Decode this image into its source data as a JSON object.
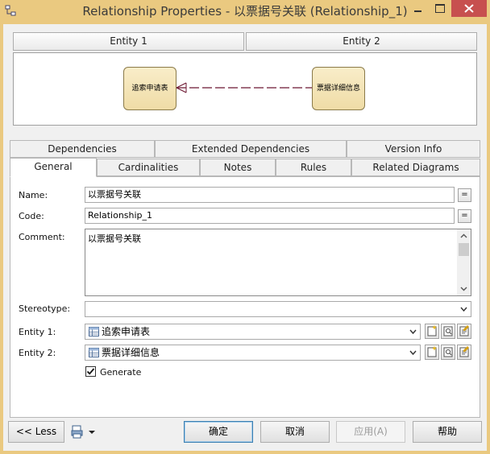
{
  "window": {
    "title": "Relationship Properties - 以票据号关联 (Relationship_1)",
    "title_bar_color": "#eac980",
    "close_color": "#c7504f"
  },
  "diagram": {
    "headers": [
      "Entity 1",
      "Entity 2"
    ],
    "entity1_label": "追索申请表",
    "entity2_label": "票据详细信息",
    "entity_fill": "#f3e2b4"
  },
  "tabs": {
    "row_back": [
      "Dependencies",
      "Extended Dependencies",
      "Version Info"
    ],
    "row_front": [
      "General",
      "Cardinalities",
      "Notes",
      "Rules",
      "Related Diagrams"
    ],
    "active": "General"
  },
  "general": {
    "name_label": "Name:",
    "name_value": "以票据号关联",
    "code_label": "Code:",
    "code_value": "Relationship_1",
    "comment_label": "Comment:",
    "comment_value": "以票据号关联",
    "stereotype_label": "Stereotype:",
    "stereotype_value": "",
    "entity1_label": "Entity 1:",
    "entity1_value": "追索申请表",
    "entity2_label": "Entity 2:",
    "entity2_value": "票据详细信息",
    "generate_label": "Generate",
    "generate_checked": true,
    "equals_btn": "="
  },
  "buttons": {
    "less": "<< Less",
    "ok": "确定",
    "cancel": "取消",
    "apply": "应用(A)",
    "help": "帮助"
  }
}
